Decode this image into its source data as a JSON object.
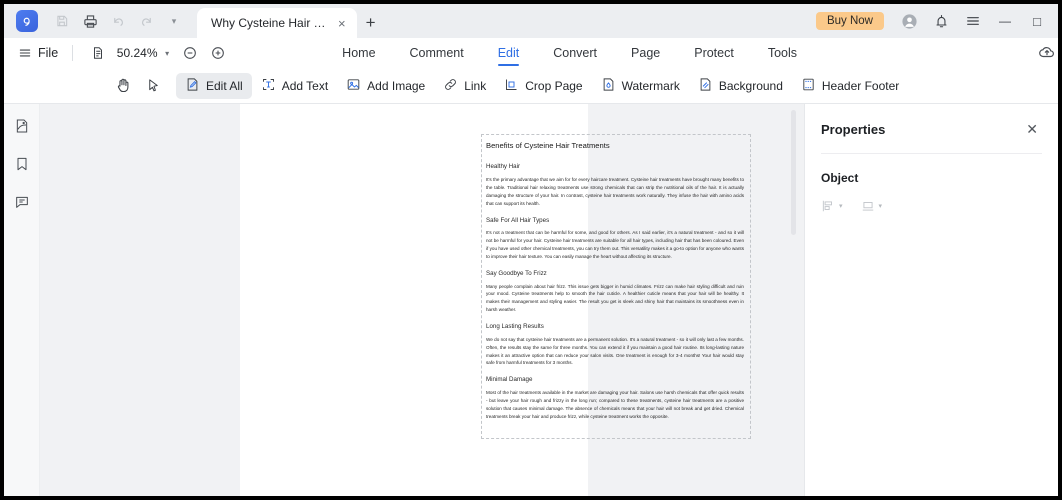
{
  "titlebar": {
    "quick_icons": [
      "save-icon",
      "print-icon",
      "undo-icon",
      "redo-icon",
      "more-caret-icon"
    ],
    "tab_label": "Why Cysteine Hair Treat...",
    "tab_close": "×",
    "new_tab": "+",
    "buy_now": "Buy Now",
    "window_buttons": [
      "account-icon",
      "notification-icon",
      "menu-icon",
      "minimize",
      "maximize"
    ],
    "minimize_glyph": "—",
    "maximize_glyph": "□",
    "accent_color": "#2f6fe4",
    "buy_now_color": "#fbc98a"
  },
  "toolbar": {
    "file_label": "File",
    "zoom_value": "50.24%",
    "zoom_out": "zoom-out-icon",
    "zoom_in": "zoom-in-icon",
    "page_fit_icon": "page-fit-icon",
    "caret": "▾"
  },
  "ribbon_tabs": [
    {
      "label": "Home",
      "active": false
    },
    {
      "label": "Comment",
      "active": false
    },
    {
      "label": "Edit",
      "active": true
    },
    {
      "label": "Convert",
      "active": false
    },
    {
      "label": "Page",
      "active": false
    },
    {
      "label": "Protect",
      "active": false
    },
    {
      "label": "Tools",
      "active": false
    }
  ],
  "ribbon_tools": [
    {
      "label": "",
      "icon": "hand-tool-icon",
      "selected": false
    },
    {
      "label": "",
      "icon": "select-cursor-icon",
      "selected": false
    },
    {
      "label": "Edit All",
      "icon": "edit-all-icon",
      "selected": true
    },
    {
      "label": "Add Text",
      "icon": "add-text-icon",
      "selected": false
    },
    {
      "label": "Add Image",
      "icon": "add-image-icon",
      "selected": false
    },
    {
      "label": "Link",
      "icon": "link-icon",
      "selected": false
    },
    {
      "label": "Crop Page",
      "icon": "crop-page-icon",
      "selected": false
    },
    {
      "label": "Watermark",
      "icon": "watermark-icon",
      "selected": false
    },
    {
      "label": "Background",
      "icon": "background-icon",
      "selected": false
    },
    {
      "label": "Header  Footer",
      "icon": "header-footer-icon",
      "selected": false
    }
  ],
  "sidebar": {
    "items": [
      {
        "name": "thumbnails-icon"
      },
      {
        "name": "bookmark-icon"
      },
      {
        "name": "comments-icon"
      }
    ]
  },
  "document": {
    "title": "Benefits of Cysteine Hair Treatments",
    "sections": [
      {
        "heading": "Healthy Hair",
        "body": "It's the primary advantage that we aim for for every haircare treatment. Cysteine hair treatments have brought many benefits to the table. Traditional hair relaxing treatments use strong chemicals that can strip the nutritional oils of the hair. It is actually damaging the structure of your hair. In contrast, cysteine hair treatments work naturally. They infuse the hair with amino acids that can support its health."
      },
      {
        "heading": "Safe For All Hair Types",
        "body": "It's not a treatment that can be harmful for some, and good for others. As I said earlier, it's a natural treatment - and so it will not be harmful for your hair. Cysteine hair treatments are suitable for all hair types, including hair that has been coloured. Even if you have used other chemical treatments, you can try them out. This versatility makes it a go-to option for anyone who wants to improve their hair texture. You can easily manage the heart without affecting its structure."
      },
      {
        "heading": "Say Goodbye To Frizz",
        "body": "Many people complain about hair frizz. This issue gets bigger in humid climates. Frizz can make hair styling difficult and ruin your mood. Cysteine treatments help to smooth the hair cuticle. A healthier cuticle means that your hair will be healthy. It makes their management and styling easier. The result you get is sleek and shiny hair that maintains its smoothness even in harsh weather."
      },
      {
        "heading": "Long Lasting Results",
        "body": "We do not say that cysteine hair treatments are a permanent solution. It's a natural treatment - so it will only last a few months. Often, the results stay the same for three months. You can extend it if you maintain a good hair routine. Its long-lasting nature makes it an attractive option that can reduce your salon visits. One treatment is enough for 3-4 months! Your hair would stay safe from harmful treatments for 3 months."
      },
      {
        "heading": "Minimal Damage",
        "body": "Most of the hair treatments available in the market are damaging your hair. Salons use harsh chemicals that offer quick results - but leave your hair rough and frizzy in the long run; compared to these treatments, cysteine hair treatments are a positive solution that causes minimal damage. The absence of chemicals means that your hair will not break and get dried. Chemical treatments break your hair and produce frizz, while cysteine treatment works the opposite."
      }
    ]
  },
  "properties": {
    "title": "Properties",
    "close": "✕",
    "section_label": "Object",
    "tools": [
      {
        "name": "align-objects-icon",
        "caret": "▾"
      },
      {
        "name": "distribute-objects-icon",
        "caret": "▾"
      }
    ]
  }
}
